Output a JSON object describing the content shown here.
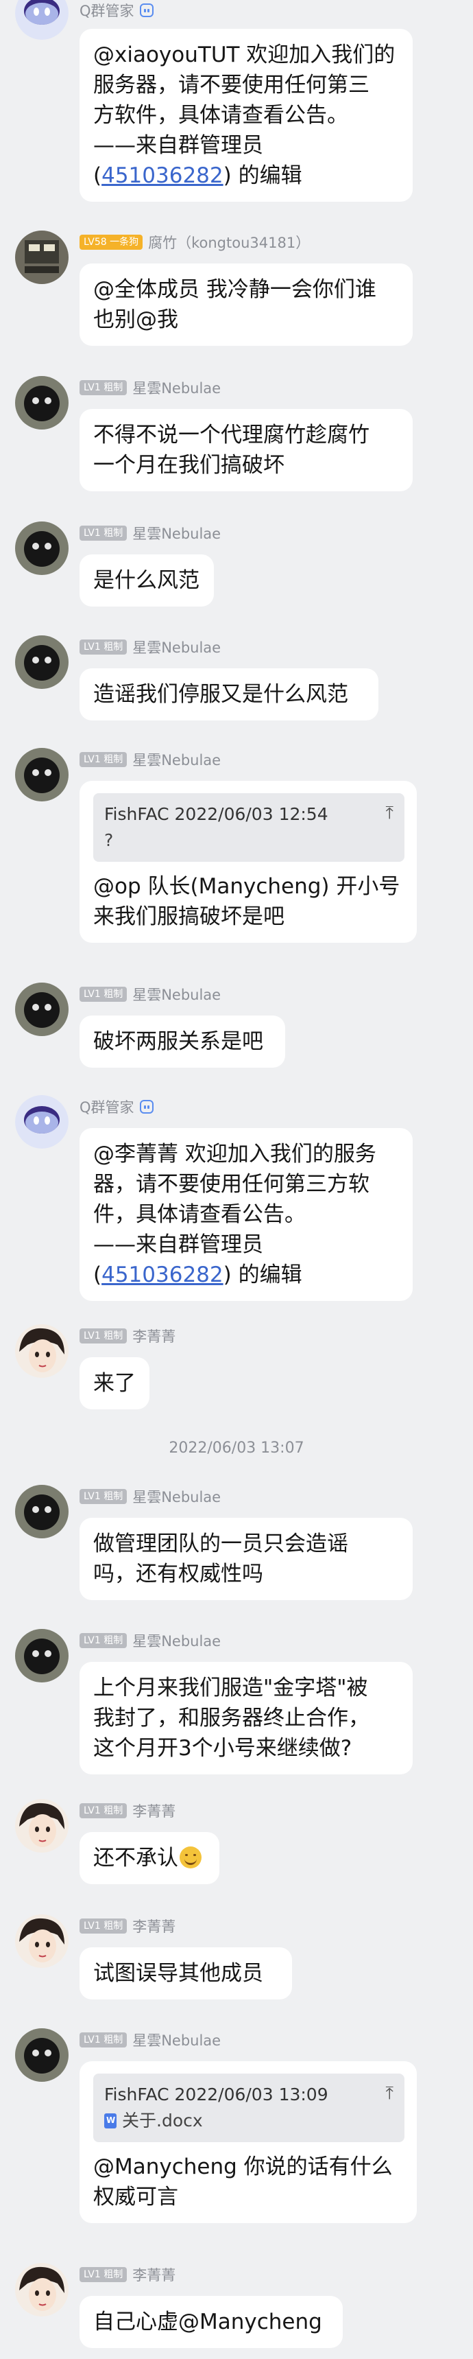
{
  "colors": {
    "background": "#eff0f2",
    "bubble": "#ffffff",
    "link": "#3a66cc",
    "badge_lv1": "#b9bbc0",
    "badge_lv58": "#f5b229",
    "meta_text": "#8c8f96"
  },
  "messages": [
    {
      "sender": "Q群管家",
      "avatar": "bot-avatar",
      "badge": "",
      "is_bot": true,
      "lines": [
        "@xiaoyouTUT 欢迎加入我们的",
        "服务器，请不要使用任何第三",
        "方软件，具体请查看公告。",
        "——来自群管理员"
      ],
      "link_prefix": "(",
      "link": "451036282",
      "link_suffix": ") 的编辑"
    },
    {
      "sender": "腐竹（kongtou34181）",
      "avatar": "admin-avatar",
      "badge": "LV58 一条狗",
      "lines": [
        "@全体成员 我冷静一会你们谁",
        "也别@我"
      ]
    },
    {
      "sender": "星雲Nebulae",
      "avatar": "nebulae-avatar",
      "badge": "LV1 粗制",
      "lines": [
        "不得不说一个代理腐竹趁腐竹",
        "一个月在我们搞破坏"
      ]
    },
    {
      "sender": "星雲Nebulae",
      "avatar": "nebulae-avatar",
      "badge": "LV1 粗制",
      "lines": [
        "是什么风范"
      ]
    },
    {
      "sender": "星雲Nebulae",
      "avatar": "nebulae-avatar",
      "badge": "LV1 粗制",
      "lines": [
        "造谣我们停服又是什么风范"
      ]
    },
    {
      "sender": "星雲Nebulae",
      "avatar": "nebulae-avatar",
      "badge": "LV1 粗制",
      "quote_head": "FishFAC 2022/06/03 12:54",
      "quote_body": "?",
      "lines": [
        "@op 队长(Manycheng) 开小号",
        "来我们服搞破坏是吧"
      ]
    },
    {
      "sender": "星雲Nebulae",
      "avatar": "nebulae-avatar",
      "badge": "LV1 粗制",
      "lines": [
        "破坏两服关系是吧"
      ]
    },
    {
      "sender": "Q群管家",
      "avatar": "bot-avatar",
      "badge": "",
      "is_bot": true,
      "lines": [
        "@李菁菁 欢迎加入我们的服务",
        "器，请不要使用任何第三方软",
        "件，具体请查看公告。",
        "——来自群管理员"
      ],
      "link_prefix": "(",
      "link": "451036282",
      "link_suffix": ") 的编辑"
    },
    {
      "sender": "李菁菁",
      "avatar": "girl-avatar",
      "badge": "LV1 粗制",
      "lines": [
        "来了"
      ]
    },
    {
      "sender": "星雲Nebulae",
      "avatar": "nebulae-avatar",
      "badge": "LV1 粗制",
      "lines": [
        "做管理团队的一员只会造谣",
        "吗，还有权威性吗"
      ]
    },
    {
      "sender": "星雲Nebulae",
      "avatar": "nebulae-avatar",
      "badge": "LV1 粗制",
      "lines": [
        "上个月来我们服造\"金字塔\"被",
        "我封了，和服务器终止合作，",
        "这个月开3个小号来继续做?"
      ]
    },
    {
      "sender": "李菁菁",
      "avatar": "girl-avatar",
      "badge": "LV1 粗制",
      "lines": [
        "还不承认"
      ],
      "emoji": "smile-emoji"
    },
    {
      "sender": "李菁菁",
      "avatar": "girl-avatar",
      "badge": "LV1 粗制",
      "lines": [
        "试图误导其他成员"
      ]
    },
    {
      "sender": "星雲Nebulae",
      "avatar": "nebulae-avatar",
      "badge": "LV1 粗制",
      "quote_head": "FishFAC 2022/06/03 13:09",
      "quote_file": "关于.docx",
      "lines": [
        "@Manycheng 你说的话有什么",
        "权威可言"
      ]
    },
    {
      "sender": "李菁菁",
      "avatar": "girl-avatar",
      "badge": "LV1 粗制",
      "lines": [
        "自己心虚@Manycheng"
      ]
    }
  ],
  "timestamp": "2022/06/03 13:07",
  "quote_icon": "arrow-up-to-line-icon"
}
